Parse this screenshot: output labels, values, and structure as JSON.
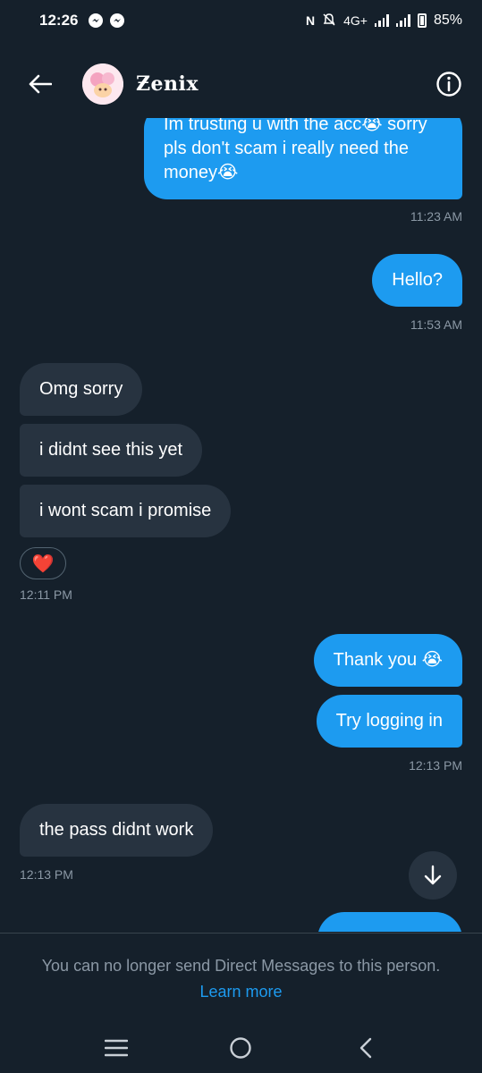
{
  "status_bar": {
    "time": "12:26",
    "network": "4G+",
    "battery": "85%"
  },
  "header": {
    "contact_name": "Ƶenix",
    "back_icon": "arrow-left-icon",
    "info_icon": "info-icon"
  },
  "messages": [
    {
      "direction": "out",
      "text": "Im trusting u with the acc😭 sorry pls don't scam i really need the money😭"
    },
    {
      "direction": "out",
      "timestamp": "11:23 AM"
    },
    {
      "direction": "out",
      "text": "Hello?"
    },
    {
      "direction": "out",
      "timestamp": "11:53 AM"
    },
    {
      "direction": "in",
      "text": "Omg sorry"
    },
    {
      "direction": "in",
      "text": "i didnt see this yet"
    },
    {
      "direction": "in",
      "text": "i wont scam i promise"
    },
    {
      "direction": "in",
      "reaction": "❤️"
    },
    {
      "direction": "in",
      "timestamp": "12:11 PM"
    },
    {
      "direction": "out",
      "text": "Thank you 😭"
    },
    {
      "direction": "out",
      "text": "Try logging in"
    },
    {
      "direction": "out",
      "timestamp": "12:13 PM"
    },
    {
      "direction": "in",
      "text": "the pass didnt work"
    },
    {
      "direction": "in",
      "timestamp": "12:13 PM"
    }
  ],
  "footer": {
    "notice": "You can no longer send Direct Messages to this person.",
    "link": "Learn more"
  },
  "colors": {
    "background": "#15202b",
    "outgoing_bubble": "#1d9bf0",
    "incoming_bubble": "#273340",
    "muted_text": "#8b98a5",
    "link": "#1d9bf0"
  }
}
